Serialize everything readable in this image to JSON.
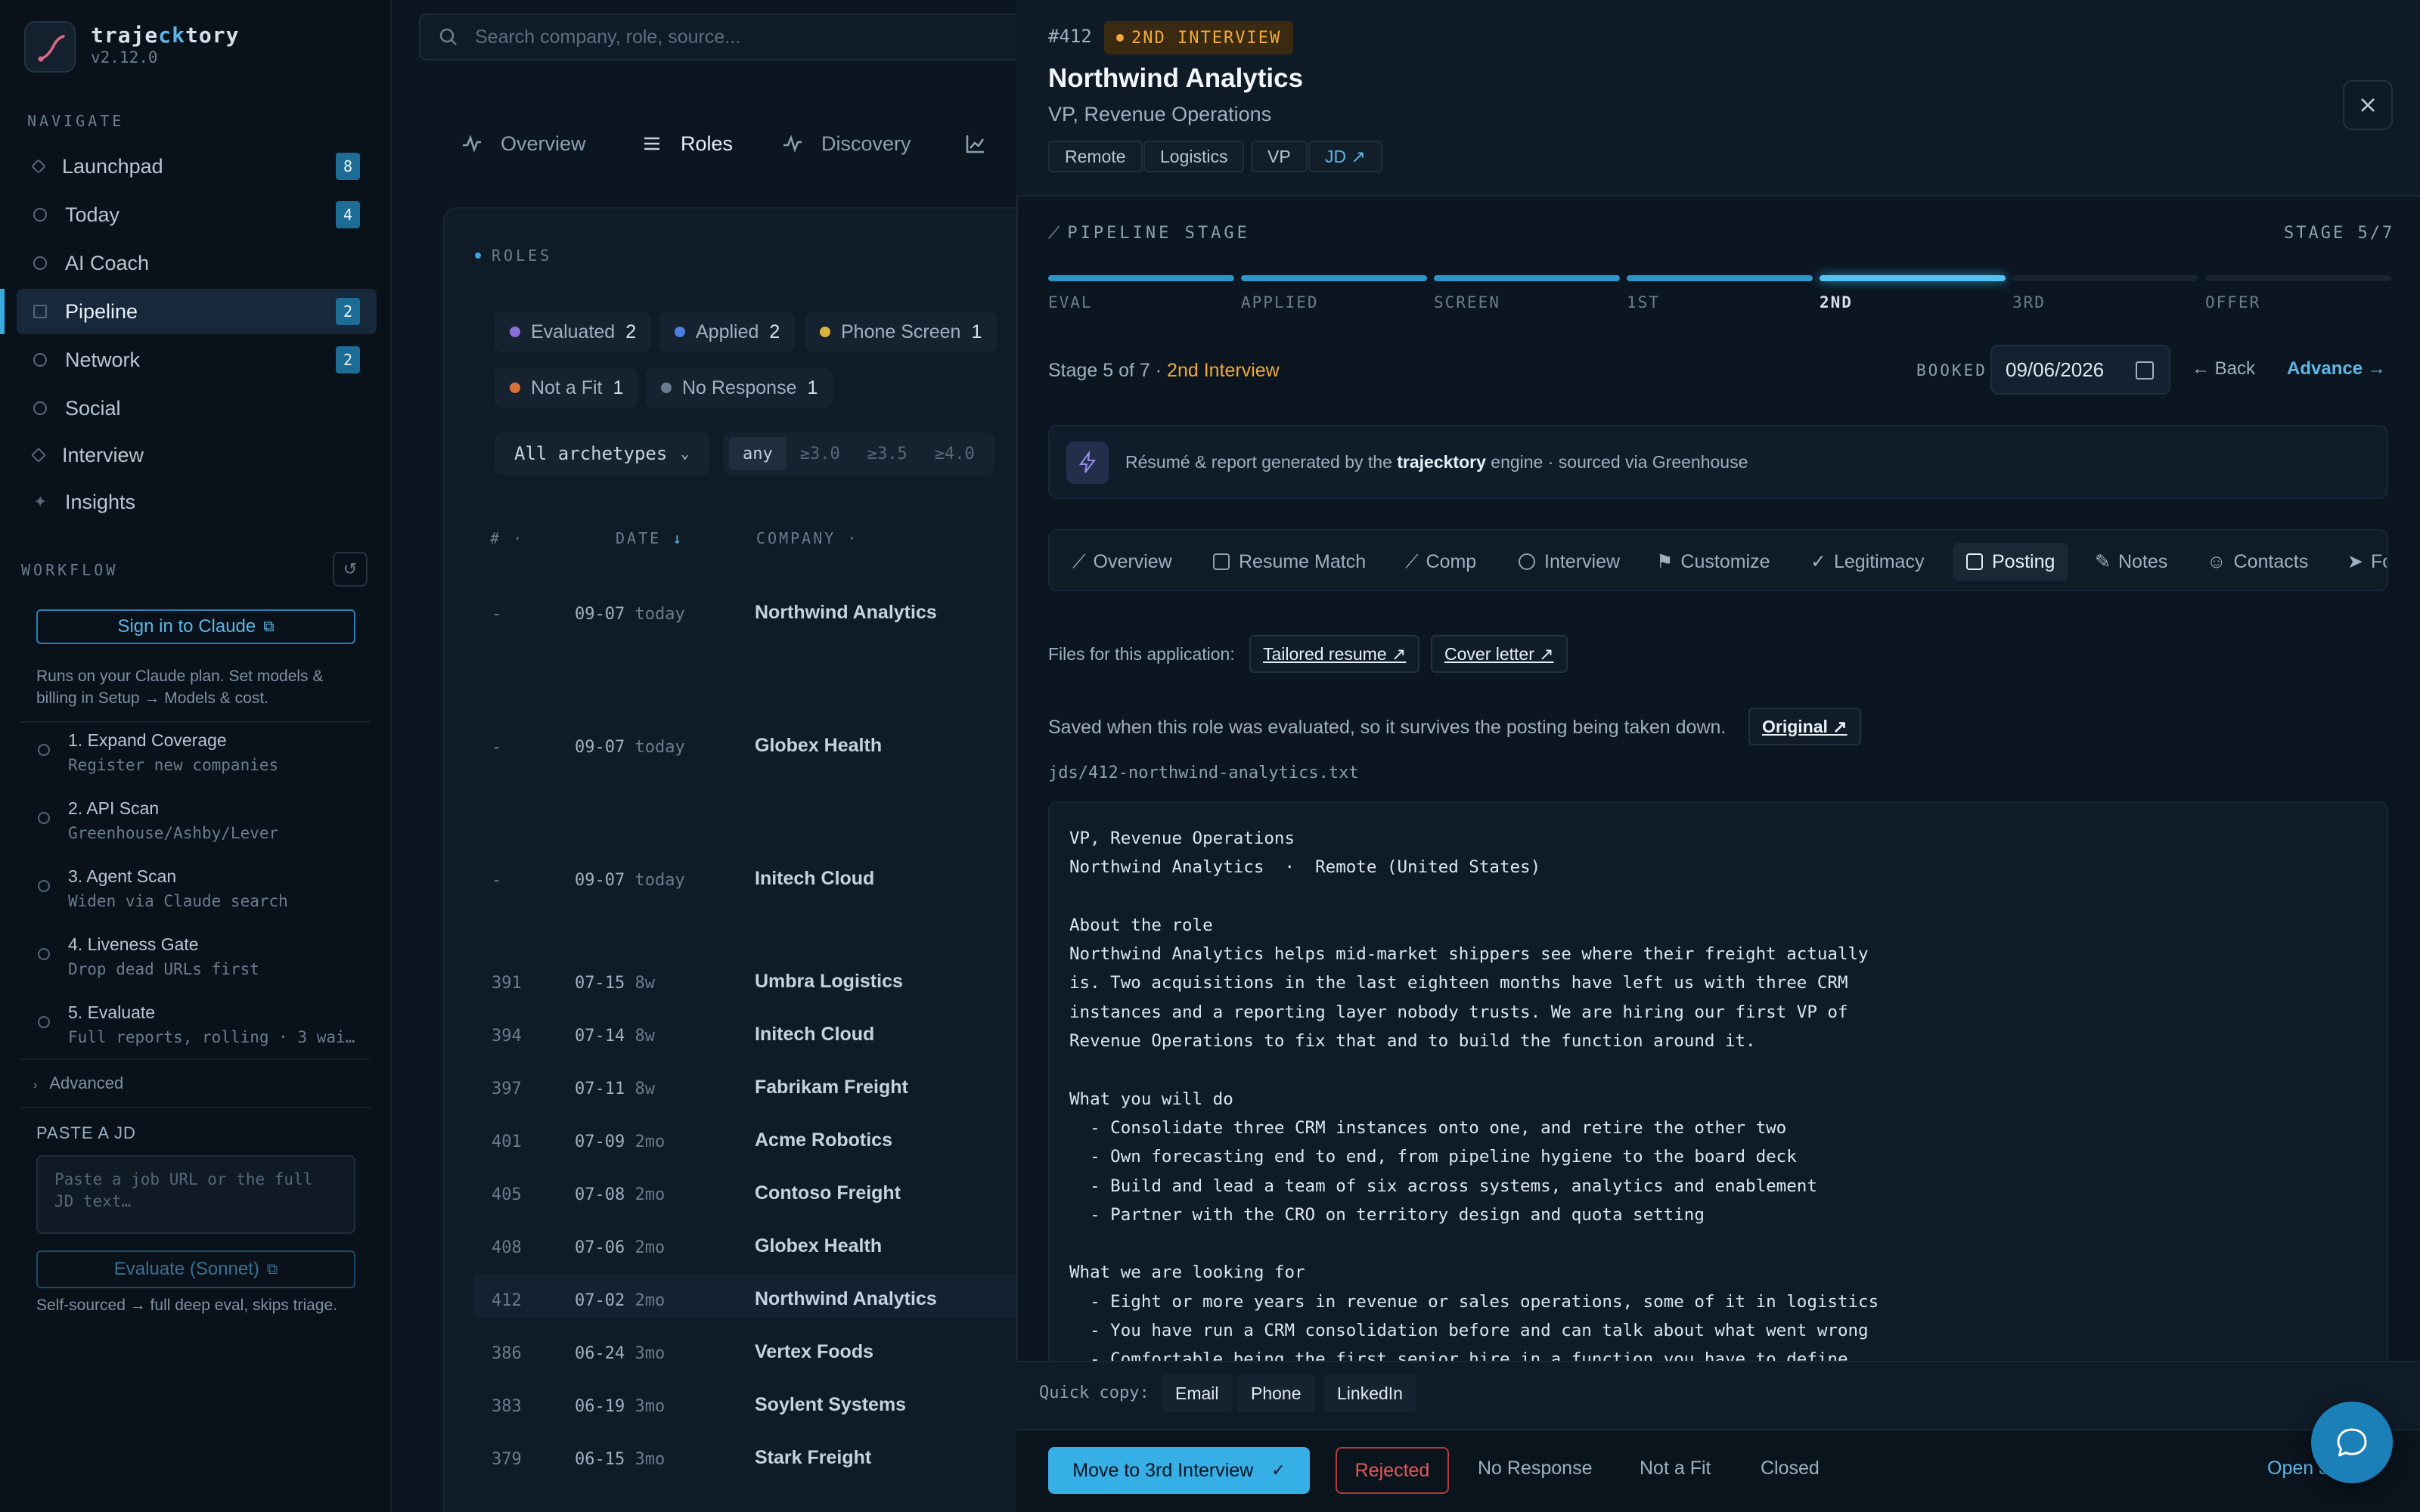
{
  "app": {
    "name_prefix": "traje",
    "name_accent": "ck",
    "name_suffix": "tory",
    "version": "v2.12.0"
  },
  "sidebar": {
    "navigate_label": "NAVIGATE",
    "items": [
      {
        "label": "Launchpad",
        "badge": "8"
      },
      {
        "label": "Today",
        "badge": "4"
      },
      {
        "label": "AI Coach",
        "badge": ""
      },
      {
        "label": "Pipeline",
        "badge": "2"
      },
      {
        "label": "Network",
        "badge": "2"
      },
      {
        "label": "Social",
        "badge": ""
      },
      {
        "label": "Interview",
        "badge": ""
      },
      {
        "label": "Insights",
        "badge": ""
      }
    ],
    "workflow_label": "WORKFLOW",
    "sign_in": "Sign in to Claude",
    "plan_note": "Runs on your Claude plan. Set models & billing in Setup → Models & cost.",
    "steps": [
      {
        "title": "1. Expand Coverage",
        "sub": "Register new companies"
      },
      {
        "title": "2. API Scan",
        "sub": "Greenhouse/Ashby/Lever"
      },
      {
        "title": "3. Agent Scan",
        "sub": "Widen via Claude search"
      },
      {
        "title": "4. Liveness Gate",
        "sub": "Drop dead URLs first"
      },
      {
        "title": "5. Evaluate",
        "sub": "Full reports, rolling · 3 wai…"
      }
    ],
    "advanced": "Advanced",
    "paste_label": "PASTE A JD",
    "paste_placeholder": "Paste a job URL or the full JD text…",
    "evaluate_btn": "Evaluate (Sonnet)",
    "self_note": "Self-sourced → full deep eval, skips triage."
  },
  "main": {
    "search_placeholder": "Search company, role, source...",
    "tabs": [
      "Overview",
      "Roles",
      "Discovery"
    ],
    "roles_label": "ROLES",
    "filters": [
      {
        "label": "Evaluated",
        "count": "2",
        "color": "#8a6fd8"
      },
      {
        "label": "Applied",
        "count": "2",
        "color": "#4a7fe0"
      },
      {
        "label": "Phone Screen",
        "count": "1",
        "color": "#d9b43a"
      },
      {
        "label": "Not a Fit",
        "count": "1",
        "color": "#d9703a"
      },
      {
        "label": "No Response",
        "count": "1",
        "color": "#6b7c8e"
      }
    ],
    "archetype": "All archetypes",
    "score_filters": [
      "any",
      "≥3.0",
      "≥3.5",
      "≥4.0"
    ],
    "columns": {
      "num": "#",
      "date": "DATE",
      "company": "COMPANY"
    },
    "rows": [
      {
        "num": "-",
        "date": "09-07",
        "age": "today",
        "company": "Northwind Analytics"
      },
      {
        "num": "-",
        "date": "09-07",
        "age": "today",
        "company": "Globex Health"
      },
      {
        "num": "-",
        "date": "09-07",
        "age": "today",
        "company": "Initech Cloud"
      },
      {
        "num": "391",
        "date": "07-15",
        "age": "8w",
        "company": "Umbra Logistics"
      },
      {
        "num": "394",
        "date": "07-14",
        "age": "8w",
        "company": "Initech Cloud"
      },
      {
        "num": "397",
        "date": "07-11",
        "age": "8w",
        "company": "Fabrikam Freight"
      },
      {
        "num": "401",
        "date": "07-09",
        "age": "2mo",
        "company": "Acme Robotics"
      },
      {
        "num": "405",
        "date": "07-08",
        "age": "2mo",
        "company": "Contoso Freight"
      },
      {
        "num": "408",
        "date": "07-06",
        "age": "2mo",
        "company": "Globex Health"
      },
      {
        "num": "412",
        "date": "07-02",
        "age": "2mo",
        "company": "Northwind Analytics"
      },
      {
        "num": "386",
        "date": "06-24",
        "age": "3mo",
        "company": "Vertex Foods"
      },
      {
        "num": "383",
        "date": "06-19",
        "age": "3mo",
        "company": "Soylent Systems"
      },
      {
        "num": "379",
        "date": "06-15",
        "age": "3mo",
        "company": "Stark Freight"
      }
    ]
  },
  "detail": {
    "id": "#412",
    "stage_badge": "2ND INTERVIEW",
    "title": "Northwind Analytics",
    "subtitle": "VP, Revenue Operations",
    "tags": [
      "Remote",
      "Logistics",
      "VP"
    ],
    "jd_tag": "JD ↗",
    "pipeline_label": "PIPELINE STAGE",
    "stage_count": "STAGE 5/7",
    "stages": [
      "EVAL",
      "APPLIED",
      "SCREEN",
      "1ST",
      "2ND",
      "3RD",
      "OFFER"
    ],
    "current_stage_index": 5,
    "stage_text_prefix": "Stage 5 of 7 · ",
    "stage_text_name": "2nd Interview",
    "booked_label": "BOOKED",
    "booked_date": "09/06/2026",
    "back": "← Back",
    "advance": "Advance →",
    "engine_prefix": "Résumé & report generated by the ",
    "engine_name": "trajecktory",
    "engine_suffix": " engine · sourced via Greenhouse",
    "tabs": [
      "Overview",
      "Resume Match",
      "Comp",
      "Interview",
      "Customize",
      "Legitimacy",
      "Posting",
      "Notes",
      "Contacts",
      "Fo"
    ],
    "active_tab": "Posting",
    "files_label": "Files for this application:",
    "files": [
      "Tailored resume ↗",
      "Cover letter ↗"
    ],
    "saved_note": "Saved when this role was evaluated, so it survives the posting being taken down.",
    "original": "Original ↗",
    "path": "jds/412-northwind-analytics.txt",
    "jd_lines": [
      "VP, Revenue Operations",
      "Northwind Analytics  ·  Remote (United States)",
      "",
      "About the role",
      "Northwind Analytics helps mid-market shippers see where their freight actually",
      "is. Two acquisitions in the last eighteen months have left us with three CRM",
      "instances and a reporting layer nobody trusts. We are hiring our first VP of",
      "Revenue Operations to fix that and to build the function around it.",
      "",
      "What you will do",
      "  - Consolidate three CRM instances onto one, and retire the other two",
      "  - Own forecasting end to end, from pipeline hygiene to the board deck",
      "  - Build and lead a team of six across systems, analytics and enablement",
      "  - Partner with the CRO on territory design and quota setting",
      "",
      "What we are looking for",
      "  - Eight or more years in revenue or sales operations, some of it in logistics",
      "  - You have run a CRM consolidation before and can talk about what went wrong",
      "  - Comfortable being the first senior hire in a function you have to define"
    ],
    "quick_copy_label": "Quick copy:",
    "quick_copy": [
      "Email",
      "Phone",
      "LinkedIn"
    ],
    "actions": {
      "move": "Move to 3rd Interview",
      "rejected": "Rejected",
      "no_response": "No Response",
      "not_fit": "Not a Fit",
      "closed": "Closed",
      "open": "Open J"
    }
  }
}
